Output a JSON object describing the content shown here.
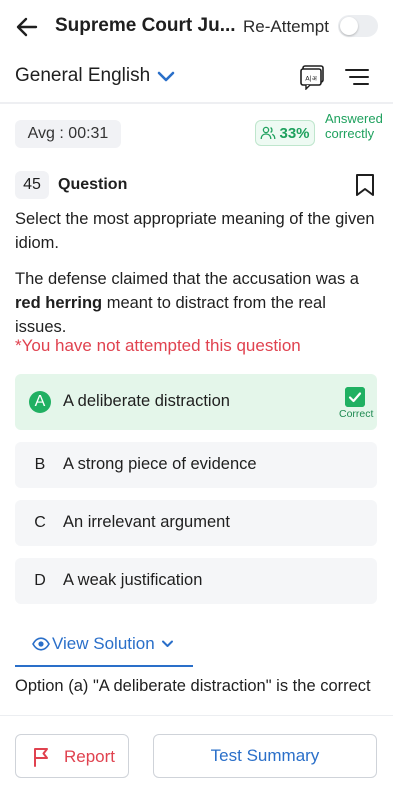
{
  "header": {
    "title": "Supreme Court Ju...",
    "reattempt_label": "Re-Attempt",
    "reattempt_on": false
  },
  "subheader": {
    "section": "General English",
    "lang_icon_text": "A|अ"
  },
  "stats": {
    "avg_time": "Avg : 00:31",
    "percent_correct": "33%",
    "answered_text": "Answered correctly"
  },
  "question": {
    "number": "45",
    "label": "Question",
    "prompt": "Select the most appropriate meaning of the given idiom.",
    "sentence_before": "The defense claimed that the accusation was a ",
    "sentence_bold": "red herring",
    "sentence_after": " meant to distract from the real issues.",
    "not_attempted": "*You have not attempted this question"
  },
  "options": [
    {
      "letter": "A",
      "text": "A deliberate distraction",
      "correct": true,
      "correct_label": "Correct"
    },
    {
      "letter": "B",
      "text": "A strong piece of evidence"
    },
    {
      "letter": "C",
      "text": "An irrelevant argument"
    },
    {
      "letter": "D",
      "text": "A weak justification"
    }
  ],
  "solution": {
    "toggle_label": "View Solution",
    "text": "Option (a) \"A deliberate distraction\" is the correct"
  },
  "footer": {
    "report_label": "Report",
    "summary_label": "Test Summary"
  },
  "colors": {
    "accent_blue": "#2a6fc9",
    "correct_green": "#20b062",
    "error_red": "#e0424f"
  }
}
